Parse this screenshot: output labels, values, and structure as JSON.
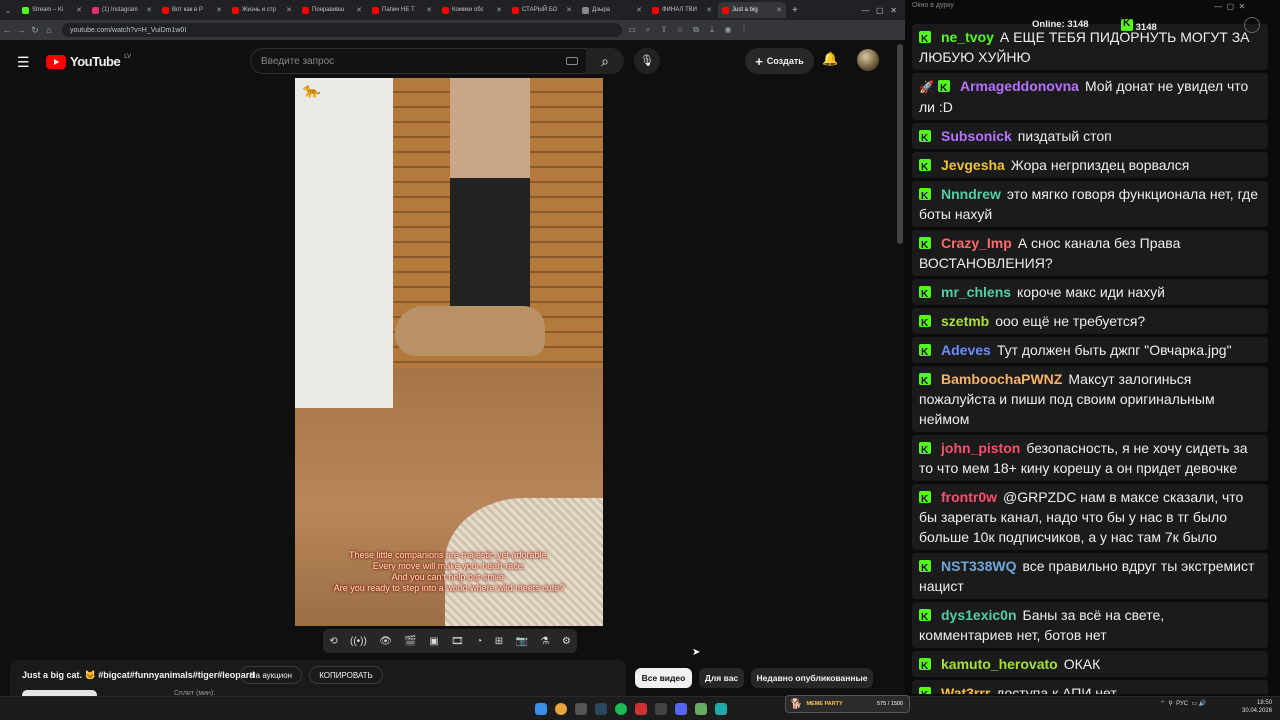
{
  "browser": {
    "tabs": [
      {
        "title": "Stream – Ki",
        "color": "#53fc18"
      },
      {
        "title": "(1) Instagram",
        "color": "#e1306c"
      },
      {
        "title": "Вот как в Р",
        "color": "#ff0000"
      },
      {
        "title": "Жизнь и стр",
        "color": "#ff0000"
      },
      {
        "title": "Понравивш",
        "color": "#ff0000"
      },
      {
        "title": "Папич НЕ Т",
        "color": "#ff0000"
      },
      {
        "title": "Комики обс",
        "color": "#ff0000"
      },
      {
        "title": "СТАРЫЙ БО",
        "color": "#ff0000"
      },
      {
        "title": "Дзыра",
        "color": "#888888"
      },
      {
        "title": "ФИНАЛ ТВИ",
        "color": "#ff0000"
      },
      {
        "title": "Just a big",
        "color": "#ff0000"
      }
    ],
    "url": "youtube.com/watch?v=H_VuiDm1w0I"
  },
  "youtube": {
    "logo_text": "YouTube",
    "region": "LV",
    "search_placeholder": "Введите запрос",
    "create_label": "Создать",
    "video": {
      "subtitles": [
        "These little companions are majestic yet adorable.",
        "Every move will make your heart race.",
        "And you can't help but smile.",
        "Are you ready to step into a world where wild meets cute?"
      ]
    },
    "title": "Just a big cat. 🐱 #bigcat#funnyanimals#tiger#leopard",
    "auction_label": "На аукцион",
    "copy_label": "КОПИРОВАТЬ",
    "split_label": "Сплит (мин):",
    "filters": [
      "Все видео",
      "Для вас",
      "Недавно опубликованные"
    ]
  },
  "chat": {
    "window_title": "Окно в дурку",
    "online_label": "Online:",
    "online_count": "3148",
    "kick_count": "3148",
    "messages": [
      {
        "user": "ne_tvoy",
        "color": "#53fc18",
        "text": "А ЕЩЕ ТЕБЯ ПИДОРНУТЬ МОГУТ ЗА ЛЮБУЮ ХУЙНЮ",
        "rocket": false
      },
      {
        "user": "Armageddonovna",
        "color": "#b673ff",
        "text": "Мой донат не увидел что ли :D",
        "rocket": true
      },
      {
        "user": "Subsonick",
        "color": "#b673ff",
        "text": "пиздатый стоп",
        "rocket": false
      },
      {
        "user": "Jevgesha",
        "color": "#f1c232",
        "text": "Жора негрпиздец ворвался",
        "rocket": false
      },
      {
        "user": "Nnndrew",
        "color": "#4fd1a5",
        "text": "это мягко говоря функционала нет, где боты нахуй",
        "rocket": false
      },
      {
        "user": "Crazy_Imp",
        "color": "#ff6b6b",
        "text": "А снос канала без Права ВОСТАНОВЛЕНИЯ?",
        "rocket": false
      },
      {
        "user": "mr_chlens",
        "color": "#4fd1a5",
        "text": "короче макс иди нахуй",
        "rocket": false
      },
      {
        "user": "szetmb",
        "color": "#a6e22e",
        "text": "ооо ещё не требуется?",
        "rocket": false
      },
      {
        "user": "Adeves",
        "color": "#6f8cff",
        "text": "Тут должен быть джпг \"Овчарка.jpg\"",
        "rocket": false
      },
      {
        "user": "BamboochaPWNZ",
        "color": "#f7b267",
        "text": "Максут залогинься пожалуйста и пиши под своим оригинальным неймом",
        "rocket": false
      },
      {
        "user": "john_piston",
        "color": "#ff4d6d",
        "text": "безопасность, я не хочу сидеть за то что мем 18+ кину корешу а он придет девочке",
        "rocket": false
      },
      {
        "user": "frontr0w",
        "color": "#ff4d6d",
        "text": "@GRPZDC нам в максе сказали, что бы зарегать канал, надо что бы у нас в тг было больше 10к подписчиков, а у нас там 7к было",
        "rocket": false
      },
      {
        "user": "NST338WQ",
        "color": "#6fa8dc",
        "text": "все правильно вдруг ты экстремист нацист",
        "rocket": false
      },
      {
        "user": "dys1exic0n",
        "color": "#4fd1a5",
        "text": "Баны за всё на свете, комментариев нет, ботов нет",
        "rocket": false
      },
      {
        "user": "kamuto_herovato",
        "color": "#a6e22e",
        "text": "ОКАК",
        "rocket": false
      },
      {
        "user": "Wat3rrr",
        "color": "#f1c232",
        "text": "доступа к АПИ нет",
        "rocket": false
      }
    ]
  },
  "taskbar": {
    "meme_label": "MEME PARTY",
    "meme_progress": "575 / 1500",
    "lang": "РУС",
    "time": "18:50",
    "date": "30.04.2026"
  }
}
